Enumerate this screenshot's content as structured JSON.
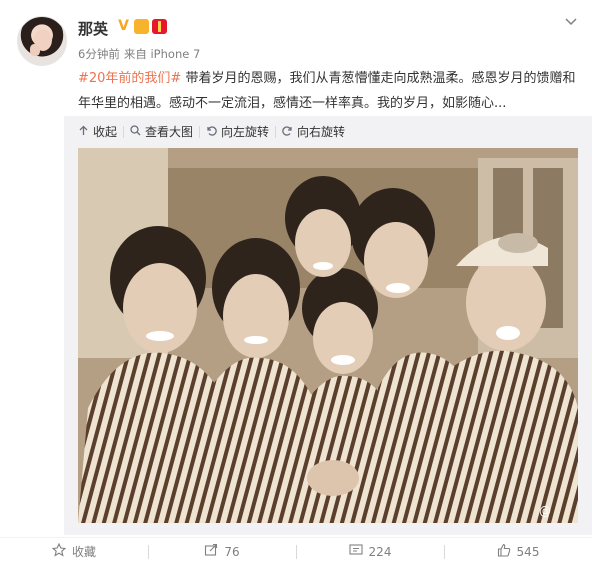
{
  "author": {
    "name": "那英",
    "avatar_icon": "avatar-photo",
    "badges": [
      "verified-v-icon",
      "vip-crown-icon",
      "red-packet-icon"
    ]
  },
  "post": {
    "time": "6分钟前",
    "source": "来自 iPhone 7",
    "topic": "#20年前的我们#",
    "body": " 带着岁月的恩赐，我们从青葱懵懂走向成熟温柔。感恩岁月的馈赠和年华里的相遇。感动不一定流泪，感情还一样率真。我的岁月，如影随心..."
  },
  "media_tools": {
    "collapse": "收起",
    "view_large": "查看大图",
    "rotate_left": "向左旋转",
    "rotate_right": "向右旋转"
  },
  "photo": {
    "description_icon": "group-photo",
    "watermark": "@"
  },
  "actions": {
    "favorite": "收藏",
    "repost_count": "76",
    "comment_count": "224",
    "like_count": "545"
  },
  "colors": {
    "topic": "#eb7350",
    "text": "#333333",
    "meta": "#808080"
  }
}
